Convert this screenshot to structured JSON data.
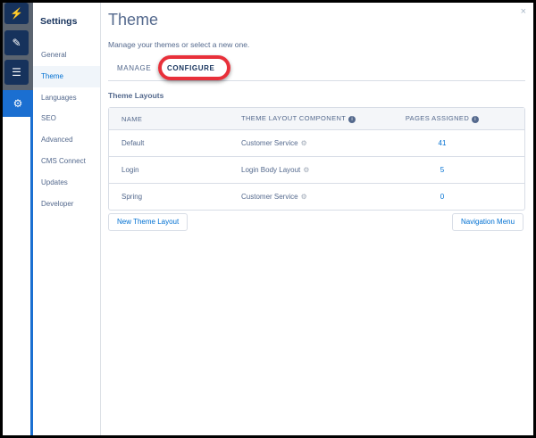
{
  "rail": {
    "items": [
      {
        "icon": "lightning-icon",
        "glyph": "⚡"
      },
      {
        "icon": "brush-icon",
        "glyph": "✎"
      },
      {
        "icon": "list-icon",
        "glyph": "☰"
      },
      {
        "icon": "gear-icon",
        "glyph": "⚙"
      }
    ]
  },
  "sidebar": {
    "title": "Settings",
    "items": [
      "General",
      "Theme",
      "Languages",
      "SEO",
      "Advanced",
      "CMS Connect",
      "Updates",
      "Developer"
    ],
    "active": "Theme"
  },
  "main": {
    "title": "Theme",
    "description": "Manage your themes or select a new one.",
    "close": "×",
    "tabs": [
      {
        "label": "MANAGE"
      },
      {
        "label": "CONFIGURE",
        "active": true
      }
    ],
    "section": "Theme Layouts",
    "table": {
      "headers": [
        "NAME",
        "THEME LAYOUT COMPONENT",
        "PAGES ASSIGNED"
      ],
      "rows": [
        [
          "Default",
          "Customer Service",
          "41"
        ],
        [
          "Login",
          "Login Body Layout",
          "5"
        ],
        [
          "Spring",
          "Customer Service",
          "0"
        ]
      ]
    },
    "new_button": "New Theme Layout",
    "nav_button": "Navigation Menu"
  },
  "colors": {
    "accent": "#0070d2",
    "highlight": "#e8303a",
    "navy": "#16325c"
  }
}
